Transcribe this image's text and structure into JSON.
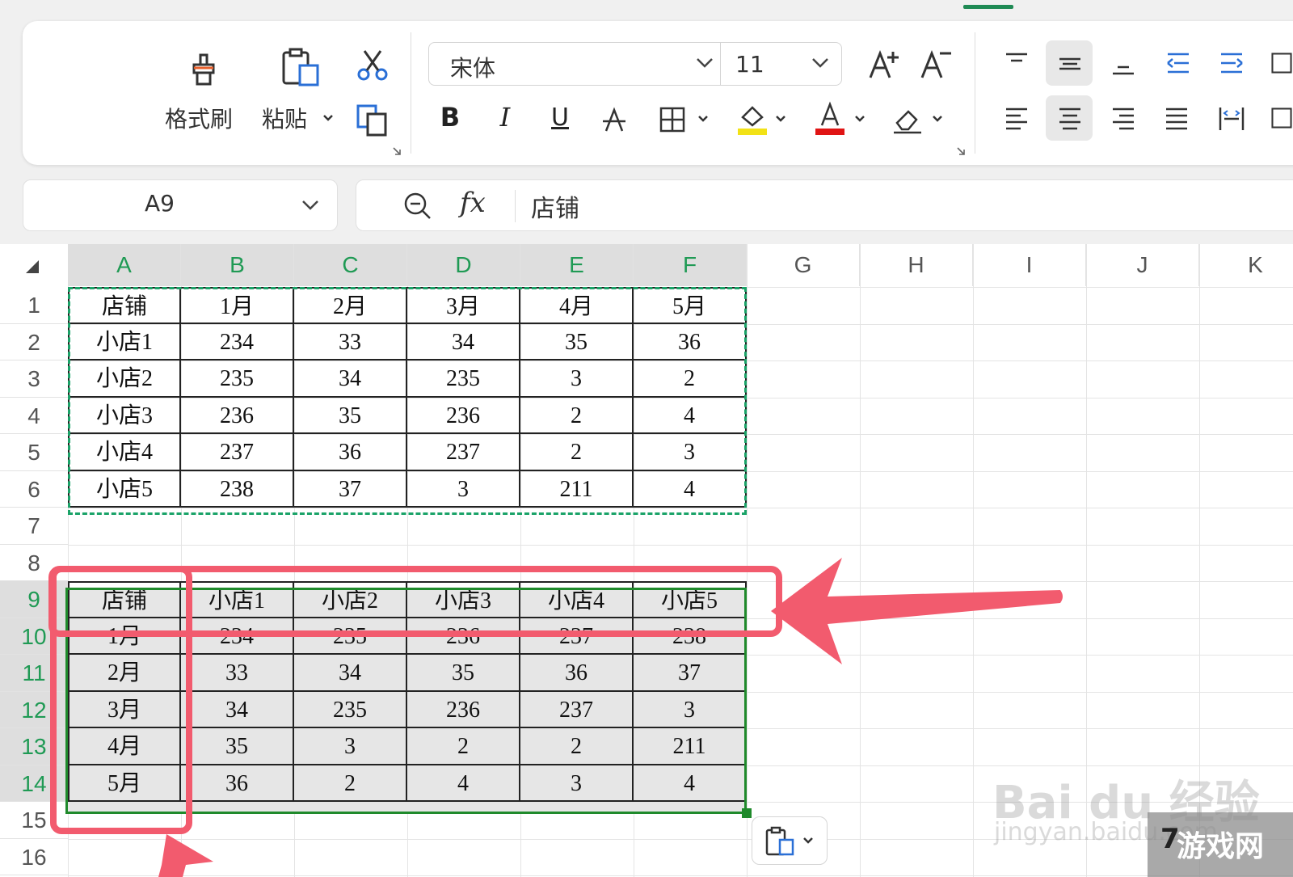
{
  "ribbon": {
    "format_painter_label": "格式刷",
    "paste_label": "粘贴",
    "font_name": "宋体",
    "font_size": "11",
    "bold_glyph": "B",
    "italic_glyph": "I",
    "underline_glyph": "U"
  },
  "name_box": {
    "value": "A9"
  },
  "formula_bar": {
    "fx_label": "fx",
    "value": "店铺"
  },
  "columns": [
    "A",
    "B",
    "C",
    "D",
    "E",
    "F",
    "G",
    "H",
    "I",
    "J",
    "K"
  ],
  "rows": [
    "1",
    "2",
    "3",
    "4",
    "5",
    "6",
    "7",
    "8",
    "9",
    "10",
    "11",
    "12",
    "13",
    "14",
    "15",
    "16"
  ],
  "source_table": [
    [
      "店铺",
      "1月",
      "2月",
      "3月",
      "4月",
      "5月"
    ],
    [
      "小店1",
      "234",
      "33",
      "34",
      "35",
      "36"
    ],
    [
      "小店2",
      "235",
      "34",
      "235",
      "3",
      "2"
    ],
    [
      "小店3",
      "236",
      "35",
      "236",
      "2",
      "4"
    ],
    [
      "小店4",
      "237",
      "36",
      "237",
      "2",
      "3"
    ],
    [
      "小店5",
      "238",
      "37",
      "3",
      "211",
      "4"
    ]
  ],
  "transposed_table": [
    [
      "店铺",
      "小店1",
      "小店2",
      "小店3",
      "小店4",
      "小店5"
    ],
    [
      "1月",
      "234",
      "235",
      "236",
      "237",
      "238"
    ],
    [
      "2月",
      "33",
      "34",
      "35",
      "36",
      "37"
    ],
    [
      "3月",
      "34",
      "235",
      "236",
      "237",
      "3"
    ],
    [
      "4月",
      "35",
      "3",
      "2",
      "2",
      "211"
    ],
    [
      "5月",
      "36",
      "2",
      "4",
      "3",
      "4"
    ]
  ],
  "watermark": {
    "brand": "Bai du 经验",
    "url": "jingyan.baidu.com"
  },
  "badge": {
    "prefix": "7",
    "text": "游戏网"
  },
  "colors": {
    "accent": "#1f8a54",
    "highlight": "#f25b6e",
    "copy_border": "#1aa368"
  }
}
